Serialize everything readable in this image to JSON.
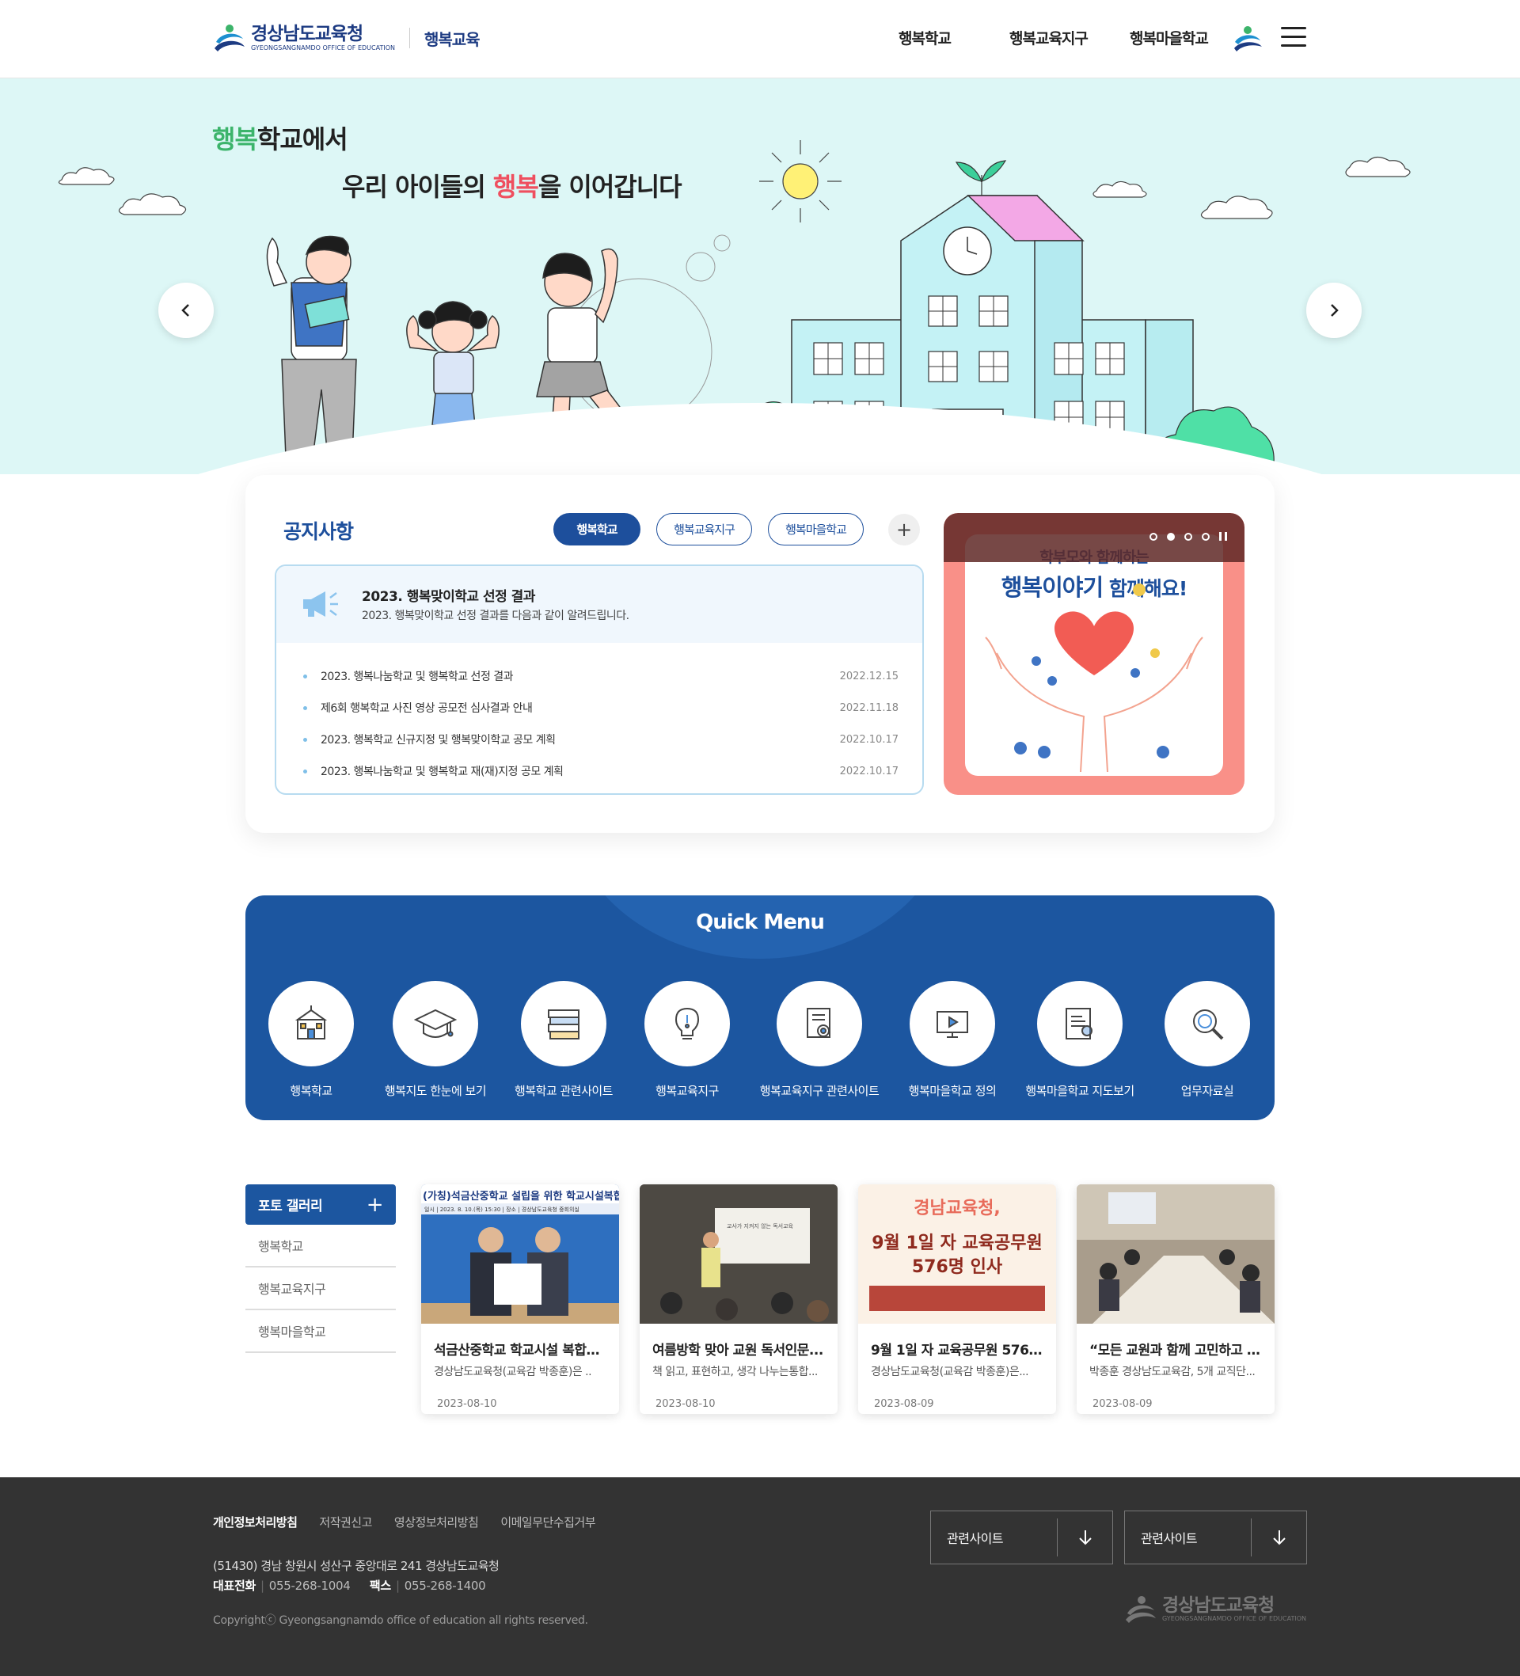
{
  "header": {
    "logo_ko": "경상남도교육청",
    "logo_en": "GYEONGSANGNAMDO OFFICE OF EDUCATION",
    "site_name": "행복교육",
    "nav": [
      "행복학교",
      "행복교육지구",
      "행복마을학교"
    ]
  },
  "hero": {
    "line1_green": "행복",
    "line1_rest": "학교에서",
    "line2_a": "우리 아이들의 ",
    "line2_pink": "행복",
    "line2_b": "을 이어갑니다"
  },
  "notice": {
    "title": "공지사항",
    "tabs": [
      "행복학교",
      "행복교육지구",
      "행복마을학교"
    ],
    "active_tab": "행복학교",
    "featured_title": "2023. 행복맞이학교 선정 결과",
    "featured_desc": "2023. 행복맞이학교 선정 결과를 다음과 같이 알려드립니다.",
    "items": [
      {
        "title": "2023. 행복나눔학교 및 행복학교 선정 결과",
        "date": "2022.12.15"
      },
      {
        "title": "제6회 행복학교 사진 영상 공모전 심사결과 안내",
        "date": "2022.11.18"
      },
      {
        "title": "2023. 행복학교 신규지정 및 행복맞이학교 공모 계획",
        "date": "2022.10.17"
      },
      {
        "title": "2023. 행복나눔학교 및 행복학교 재(재)지정 공모 계획",
        "date": "2022.10.17"
      }
    ]
  },
  "banner": {
    "line1": "학부모와 함께하는",
    "line2_big": "행복이야기",
    "line2_rest": " 함께해요!",
    "slide_count": 4,
    "active_slide": 2
  },
  "quick_menu": {
    "title": "Quick Menu",
    "items": [
      {
        "label": "행복학교",
        "icon": "school-icon"
      },
      {
        "label": "행복지도 한눈에 보기",
        "icon": "graduation-cap-icon"
      },
      {
        "label": "행복학교 관련사이트",
        "icon": "books-icon"
      },
      {
        "label": "행복교육지구",
        "icon": "lightbulb-icon"
      },
      {
        "label": "행복교육지구 관련사이트",
        "icon": "certificate-icon"
      },
      {
        "label": "행복마을학교 정의",
        "icon": "video-icon"
      },
      {
        "label": "행복마을학교 지도보기",
        "icon": "document-icon"
      },
      {
        "label": "업무자료실",
        "icon": "magnifier-icon"
      }
    ]
  },
  "gallery": {
    "title": "포토 갤러리",
    "links": [
      "행복학교",
      "행복교육지구",
      "행복마을학교"
    ],
    "cards": [
      {
        "title": "석금산중학교 학교시설 복합화..",
        "desc": "경상남도교육청(교육감 박종훈)은 ..",
        "date": "2023-08-10",
        "thumb_caption": "(가칭)석금산중학교 설립을 위한 학교시설복합화",
        "thumb_sub": "일시 | 2023. 8. 10.(목) 15:30  |  장소 | 경상남도교육청 중회의실"
      },
      {
        "title": "여름방학 맞아 교원 독서인문...",
        "desc": "책 읽고, 표현하고, 생각 나누는통합...",
        "date": "2023-08-10",
        "thumb_caption": "교사가 지켜지 않는 독서교육"
      },
      {
        "title": "9월 1일 자 교육공무원 576명...",
        "desc": "경상남도교육청(교육감 박종훈)은...",
        "date": "2023-08-09",
        "thumb_caption": "경남교육청,",
        "thumb_main1": "9월 1일 자 교육공무원",
        "thumb_main2": "576명 인사"
      },
      {
        "title": "“모든 교원과 함께 고민하고 만...",
        "desc": "박종훈 경상남도교육감, 5개 교직단...",
        "date": "2023-08-09"
      }
    ]
  },
  "footer": {
    "links": [
      "개인정보처리방침",
      "저작권신고",
      "영상정보처리방침",
      "이메일무단수집거부"
    ],
    "address": "(51430) 경남 창원시 성산구 중앙대로 241 경상남도교육청",
    "tel_label": "대표전화",
    "tel": "055-268-1004",
    "fax_label": "팩스",
    "fax": "055-268-1400",
    "copyright": "Copyrightⓒ Gyeongsangnamdo office of education all rights reserved.",
    "selects": [
      "관련사이트",
      "관련사이트"
    ],
    "logo_ko": "경상남도교육청",
    "logo_en": "GYEONGSANGNAMDO OFFICE OF EDUCATION"
  },
  "colors": {
    "brand_blue": "#1c56a0",
    "accent_green": "#3cb46b",
    "accent_pink": "#ef4f5f",
    "hero_bg": "#ddf7f6",
    "footer_bg": "#333333"
  }
}
